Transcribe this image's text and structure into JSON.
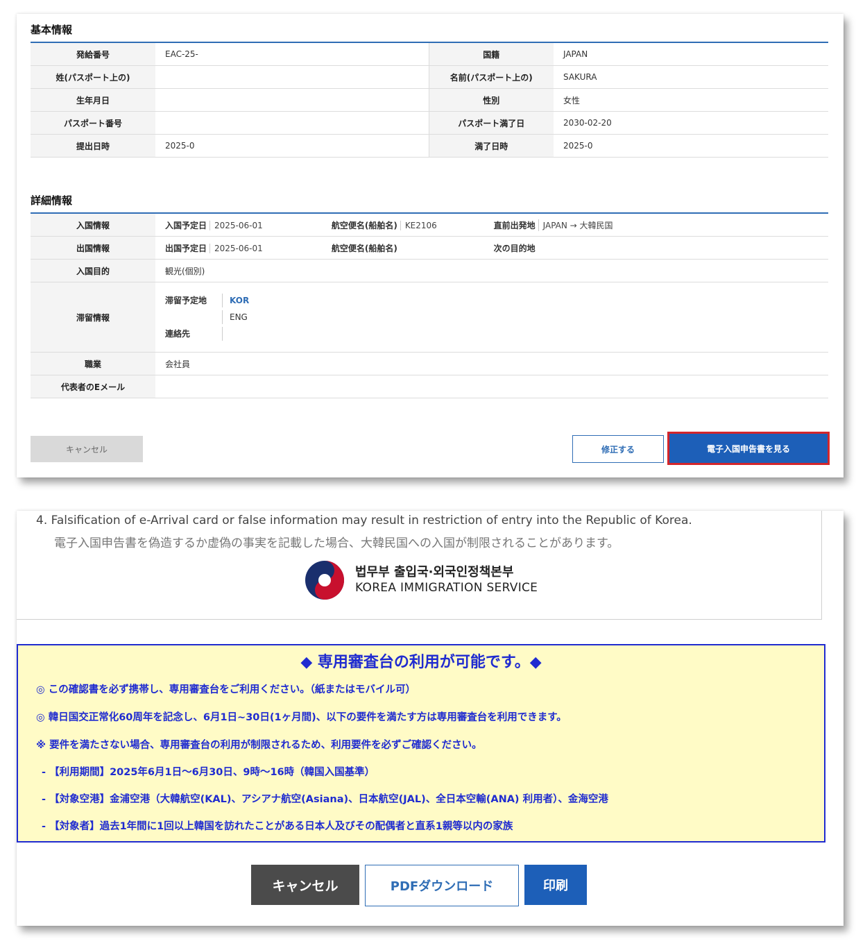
{
  "basic": {
    "title": "基本情報",
    "rows": [
      {
        "l1": "発給番号",
        "v1": "EAC-25-",
        "l2": "国籍",
        "v2": "JAPAN"
      },
      {
        "l1": "姓(パスポート上の)",
        "v1": "",
        "l2": "名前(パスポート上の)",
        "v2": "SAKURA"
      },
      {
        "l1": "生年月日",
        "v1": "",
        "l2": "性別",
        "v2": "女性"
      },
      {
        "l1": "パスポート番号",
        "v1": "",
        "l2": "パスポート満了日",
        "v2": "2030-02-20"
      },
      {
        "l1": "提出日時",
        "v1": "2025-0",
        "l2": "満了日時",
        "v2": "2025-0"
      }
    ]
  },
  "detail": {
    "title": "詳細情報",
    "entry": {
      "label": "入国情報",
      "date_lbl": "入国予定日",
      "date_val": "2025-06-01",
      "flight_lbl": "航空便名(船舶名)",
      "flight_val": "KE2106",
      "dep_lbl": "直前出発地",
      "dep_val": "JAPAN → 大韓民国"
    },
    "exit": {
      "label": "出国情報",
      "date_lbl": "出国予定日",
      "date_val": "2025-06-01",
      "flight_lbl": "航空便名(船舶名)",
      "flight_val": "",
      "next_lbl": "次の目的地",
      "next_val": ""
    },
    "purpose": {
      "label": "入国目的",
      "value": "観光(個別)"
    },
    "stay": {
      "label": "滞留情報",
      "addr_lbl": "滞留予定地",
      "addr_kor": "KOR",
      "addr_eng": "ENG",
      "contact_lbl": "連絡先",
      "contact_val": ""
    },
    "job": {
      "label": "職業",
      "value": "会社員"
    },
    "email": {
      "label": "代表者のEメール",
      "value": ""
    }
  },
  "top_buttons": {
    "cancel": "キャンセル",
    "edit": "修正する",
    "view": "電子入国申告書を見る"
  },
  "notice": {
    "en": "4. Falsification of e-Arrival card or false information may result in restriction of entry into the Republic of Korea.",
    "ja": "電子入国申告書を偽造するか虚偽の事実を記載した場合、大韓民国への入国が制限されることがあります。"
  },
  "logo": {
    "ko": "법무부 출입국·외국인정책본부",
    "en": "KOREA IMMIGRATION SERVICE"
  },
  "announcement": {
    "title": "◆ 専用審査台の利用が可能です。◆",
    "lines": [
      "◎ この確認書を必ず携帯し、専用審査台をご利用ください。（紙またはモバイル可）",
      "◎ 韓日国交正常化60周年を記念し、6月1日~30日(1ヶ月間)、以下の要件を満たす方は専用審査台を利用できます。",
      "※ 要件を満たさない場合、専用審査台の利用が制限されるため、利用要件を必ずご確認ください。",
      "- 【利用期間】2025年6月1日～6月30日、9時～16時（韓国入国基準）",
      "- 【対象空港】金浦空港（大韓航空(KAL)、アシアナ航空(Asiana)、日本航空(JAL)、全日本空輸(ANA) 利用者）、金海空港",
      "- 【対象者】過去1年間に1回以上韓国を訪れたことがある日本人及びその配偶者と直系1親等以内の家族"
    ]
  },
  "bottom_buttons": {
    "cancel": "キャンセル",
    "pdf": "PDFダウンロード",
    "print": "印刷"
  },
  "colors": {
    "accent": "#1d5fb8",
    "highlight": "#d3262b",
    "notice_bg": "#fffbc6",
    "notice_text": "#1f2bd0"
  }
}
